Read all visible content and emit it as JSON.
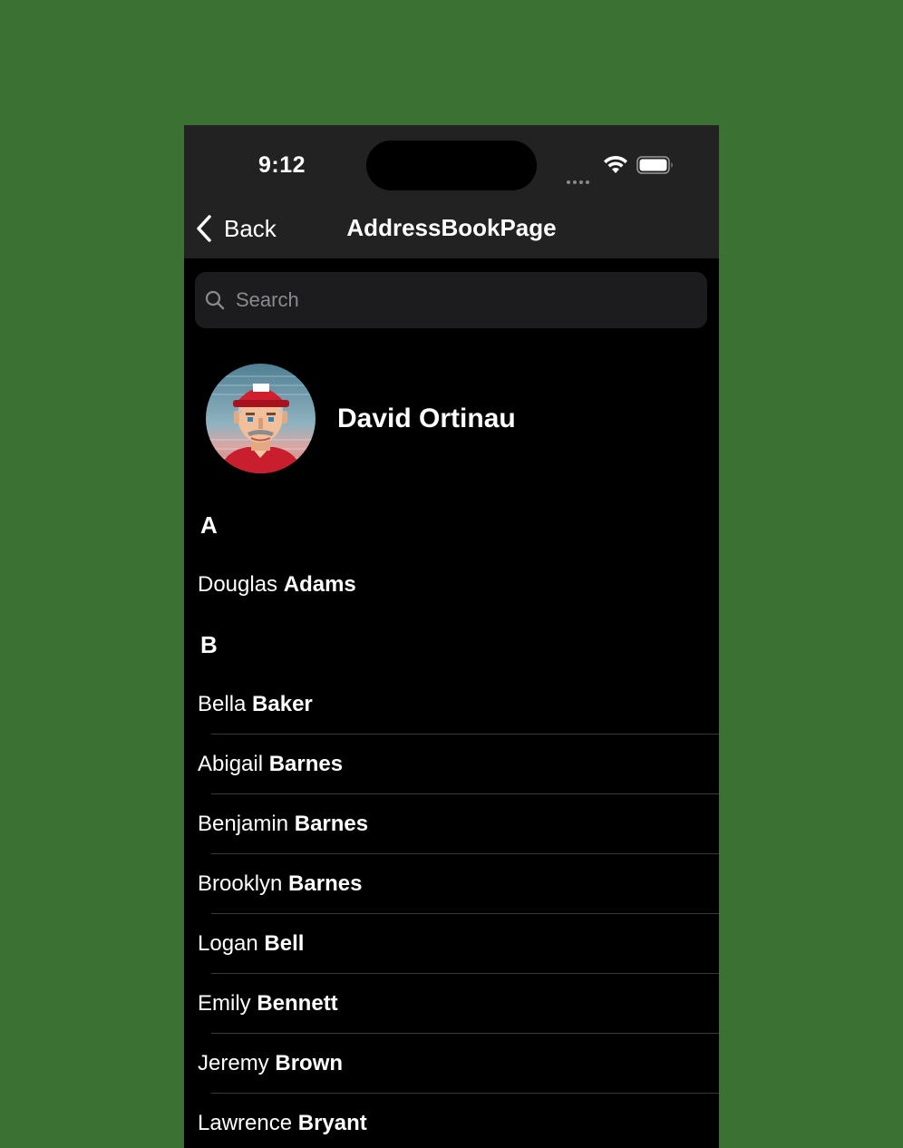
{
  "status": {
    "time": "9:12"
  },
  "nav": {
    "back_label": "Back",
    "title": "AddressBookPage"
  },
  "search": {
    "placeholder": "Search",
    "value": ""
  },
  "profile": {
    "name": "David Ortinau"
  },
  "sections": [
    {
      "letter": "A",
      "contacts": [
        {
          "first": "Douglas",
          "last": "Adams"
        }
      ]
    },
    {
      "letter": "B",
      "contacts": [
        {
          "first": "Bella",
          "last": "Baker"
        },
        {
          "first": "Abigail",
          "last": "Barnes"
        },
        {
          "first": "Benjamin",
          "last": "Barnes"
        },
        {
          "first": "Brooklyn",
          "last": "Barnes"
        },
        {
          "first": "Logan",
          "last": "Bell"
        },
        {
          "first": "Emily",
          "last": "Bennett"
        },
        {
          "first": "Jeremy",
          "last": "Brown"
        },
        {
          "first": "Lawrence",
          "last": "Bryant"
        }
      ]
    }
  ],
  "colors": {
    "background": "#3b7233",
    "topbar": "#222222",
    "list_background": "#000000",
    "search_field": "#1c1c1e",
    "separator": "#3a3a3c"
  }
}
